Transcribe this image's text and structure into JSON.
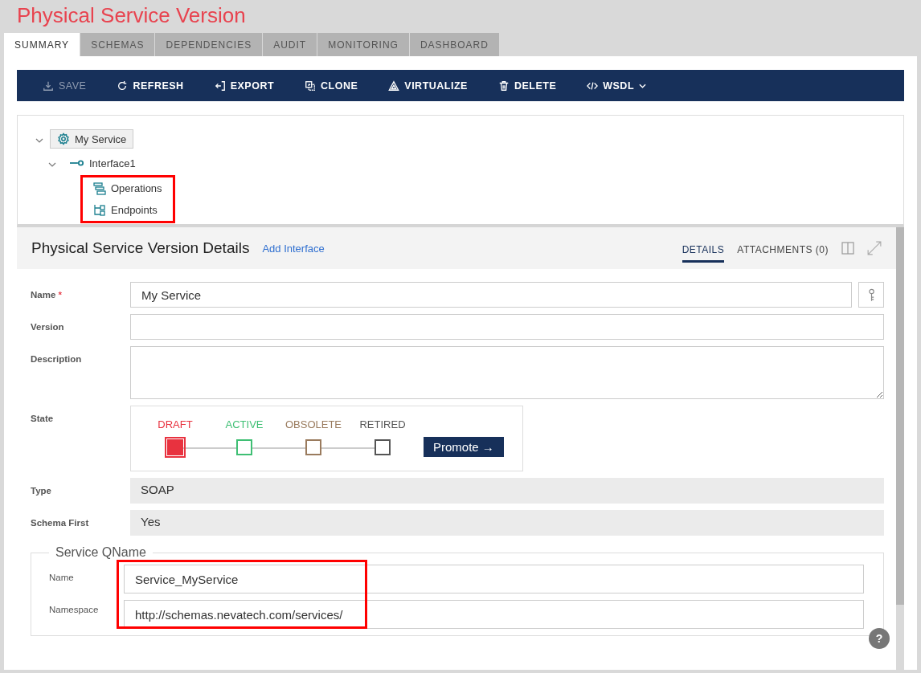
{
  "page_title": "Physical Service Version",
  "tabs": [
    {
      "label": "SUMMARY",
      "selected": true
    },
    {
      "label": "SCHEMAS",
      "selected": false
    },
    {
      "label": "DEPENDENCIES",
      "selected": false
    },
    {
      "label": "AUDIT",
      "selected": false
    },
    {
      "label": "MONITORING",
      "selected": false
    },
    {
      "label": "DASHBOARD",
      "selected": false
    }
  ],
  "toolbar": [
    {
      "label": "SAVE",
      "disabled": true,
      "has_menu": false
    },
    {
      "label": "REFRESH",
      "disabled": false,
      "has_menu": false
    },
    {
      "label": "EXPORT",
      "disabled": false,
      "has_menu": false
    },
    {
      "label": "CLONE",
      "disabled": false,
      "has_menu": false
    },
    {
      "label": "VIRTUALIZE",
      "disabled": false,
      "has_menu": false
    },
    {
      "label": "DELETE",
      "disabled": false,
      "has_menu": false
    },
    {
      "label": "WSDL",
      "disabled": false,
      "has_menu": true
    }
  ],
  "tree": [
    {
      "label": "My Service",
      "selected": true,
      "expanded": true,
      "children": [
        {
          "label": "Interface1",
          "selected": false,
          "expanded": true,
          "children": [
            {
              "label": "Operations",
              "selected": false
            },
            {
              "label": "Endpoints",
              "selected": false
            }
          ]
        }
      ]
    }
  ],
  "details": {
    "title": "Physical Service Version Details",
    "link": "Add Interface",
    "tabs": [
      {
        "label": "DETAILS",
        "selected": true
      },
      {
        "label": "ATTACHMENTS (0)",
        "selected": false
      }
    ],
    "fields": [
      {
        "kind": "text",
        "label": "Name",
        "required_mark": "*",
        "key_button": true,
        "value": "My Service"
      },
      {
        "kind": "text",
        "label": "Version",
        "key_button": false
      },
      {
        "kind": "textarea",
        "label": "Description"
      },
      {
        "kind": "state",
        "label": "State"
      },
      {
        "kind": "readonly",
        "label": "Type",
        "value": "SOAP"
      },
      {
        "kind": "readonly",
        "label": "Schema First",
        "value": "Yes"
      }
    ],
    "states": [
      {
        "label": "DRAFT",
        "color": "#e8323f",
        "selected": true
      },
      {
        "label": "ACTIVE",
        "color": "#3fbf74",
        "selected": false
      },
      {
        "label": "OBSOLETE",
        "color": "#9a7b5e",
        "selected": false
      },
      {
        "label": "RETIRED",
        "color": "#555555",
        "selected": false
      }
    ],
    "promote_button": "Promote →",
    "qname": {
      "legend": "Service QName",
      "fields": [
        {
          "label": "Name",
          "value": "Service_MyService"
        },
        {
          "label": "Namespace",
          "value": "http://schemas.nevatech.com/services/"
        }
      ]
    }
  },
  "help_button": "?"
}
